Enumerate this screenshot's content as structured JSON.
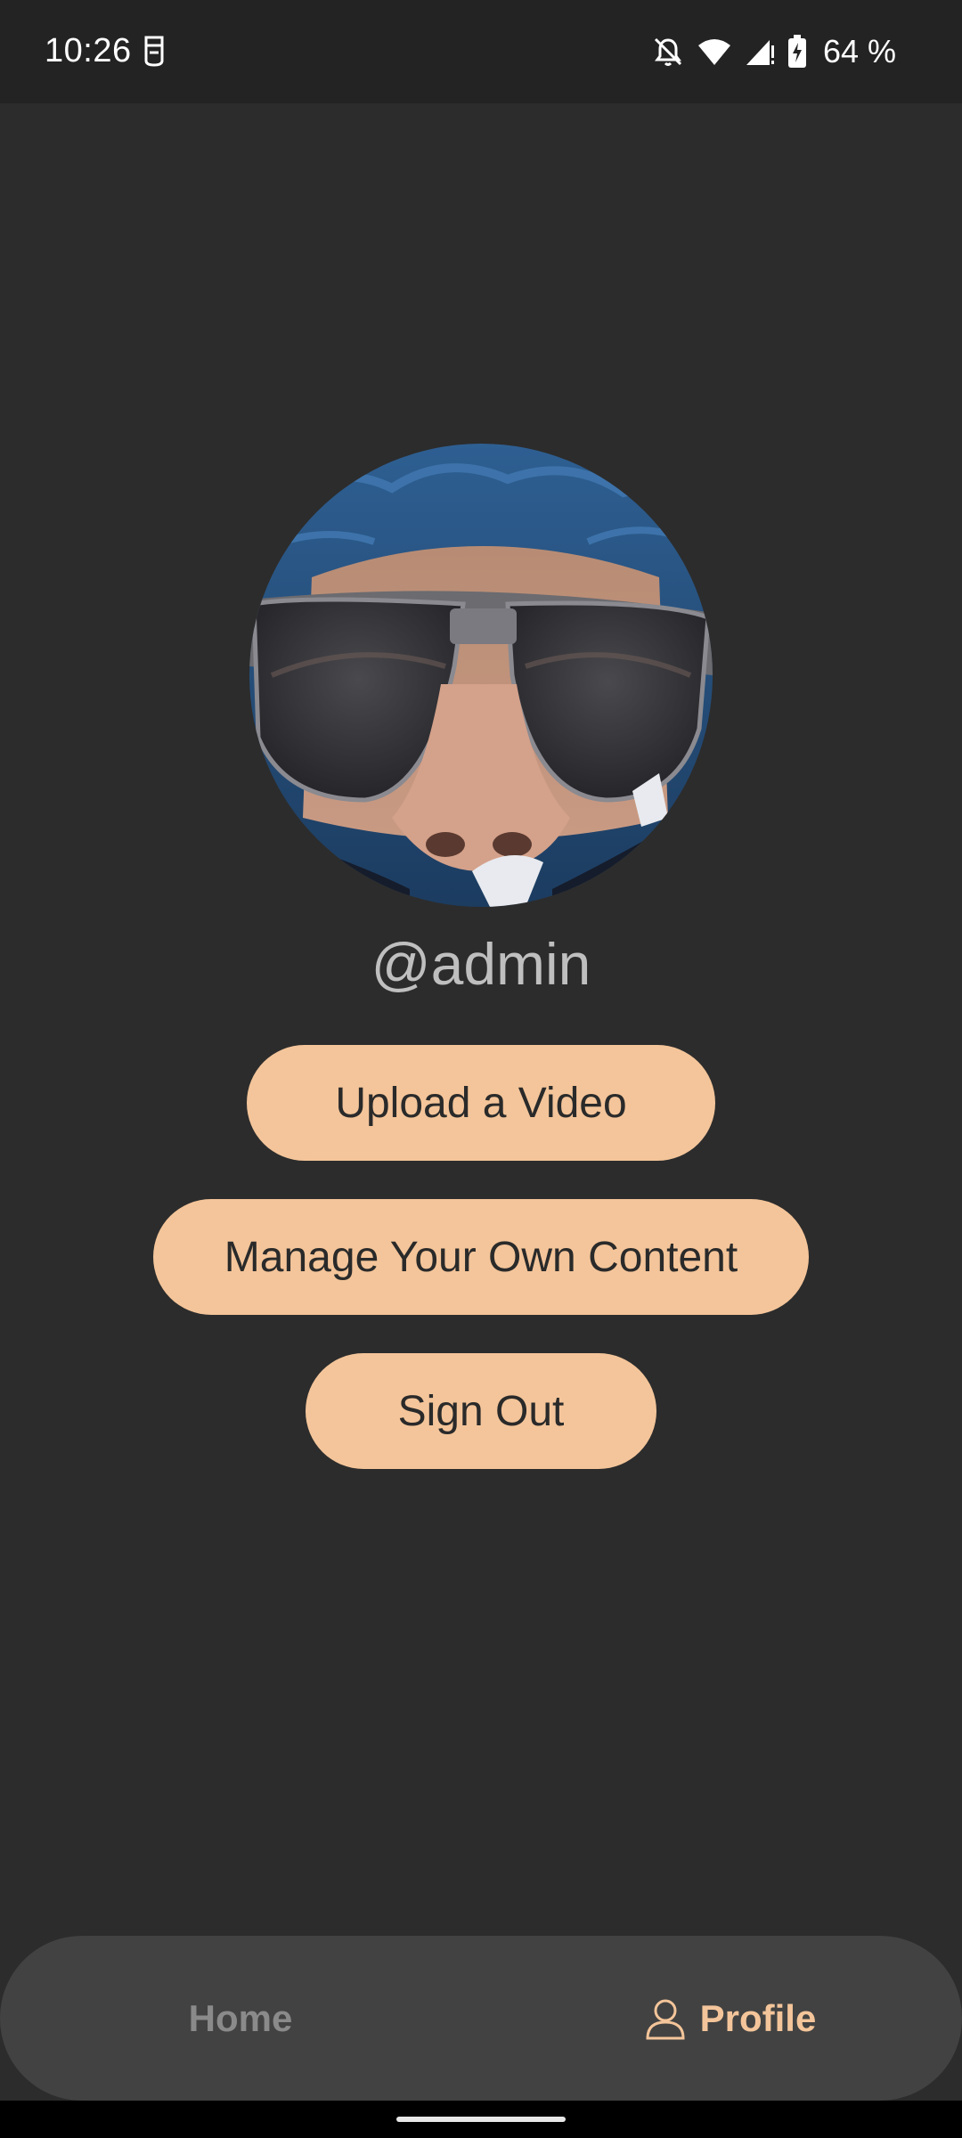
{
  "status_bar": {
    "time": "10:26",
    "battery": "64 %",
    "icons": [
      "notification-icon",
      "mute-bell-icon",
      "wifi-icon",
      "signal-icon",
      "battery-charging-icon"
    ]
  },
  "profile": {
    "username": "@admin",
    "avatar": "profile-avatar-photo"
  },
  "actions": {
    "upload_label": "Upload a Video",
    "manage_label": "Manage Your Own Content",
    "signout_label": "Sign Out"
  },
  "bottom_nav": {
    "home_label": "Home",
    "profile_label": "Profile",
    "active": "Profile"
  },
  "colors": {
    "background": "#2c2c2c",
    "accent": "#f4c59a",
    "nav_background": "#424242",
    "inactive_nav": "#8a8a8a"
  }
}
